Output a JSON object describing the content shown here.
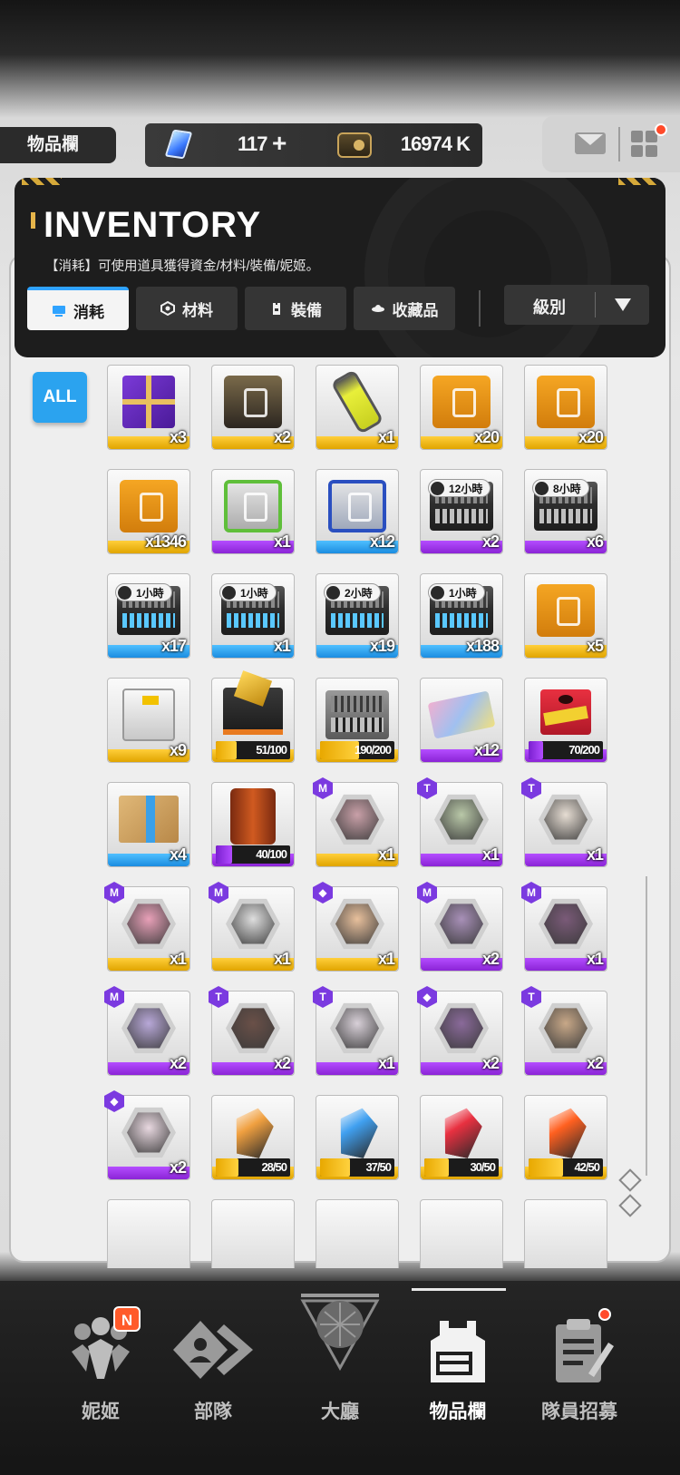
{
  "topbar": {
    "page_label": "物品欄",
    "gems": "117",
    "gems_plus": "+",
    "credits": "16974 K"
  },
  "inventory": {
    "title": "INVENTORY",
    "description": "【消耗】可使用道具獲得資金/材料/裝備/妮姬。",
    "tabs": [
      {
        "label": "消耗",
        "icon": "consumable-icon",
        "active": true
      },
      {
        "label": "材料",
        "icon": "material-icon",
        "active": false
      },
      {
        "label": "裝備",
        "icon": "equipment-icon",
        "active": false
      },
      {
        "label": "收藏品",
        "icon": "collection-icon",
        "active": false
      }
    ],
    "sort_label": "級別",
    "filter_all": "ALL"
  },
  "items": [
    {
      "kind": "gift",
      "rarity": "gold",
      "count": "x3"
    },
    {
      "kind": "crate-dark",
      "rarity": "gold",
      "count": "x2"
    },
    {
      "kind": "canister",
      "rarity": "gold",
      "count": "x1"
    },
    {
      "kind": "crate-orange",
      "rarity": "gold",
      "count": "x20"
    },
    {
      "kind": "crate-orange",
      "rarity": "gold",
      "count": "x20"
    },
    {
      "kind": "crate-orange",
      "rarity": "gold",
      "count": "x1346"
    },
    {
      "kind": "crate-green",
      "rarity": "purple",
      "count": "x1"
    },
    {
      "kind": "crate-blue",
      "rarity": "blue",
      "count": "x12"
    },
    {
      "kind": "case",
      "rarity": "purple",
      "count": "x2",
      "timer": "12小時"
    },
    {
      "kind": "case",
      "rarity": "purple",
      "count": "x6",
      "timer": "8小時"
    },
    {
      "kind": "case",
      "rarity": "blue",
      "count": "x17",
      "timer": "1小時"
    },
    {
      "kind": "case",
      "rarity": "blue",
      "count": "x1",
      "timer": "1小時"
    },
    {
      "kind": "case",
      "rarity": "blue",
      "count": "x19",
      "timer": "2小時"
    },
    {
      "kind": "case",
      "rarity": "blue",
      "count": "x188",
      "timer": "1小時"
    },
    {
      "kind": "crate-orange",
      "rarity": "gold",
      "count": "x5"
    },
    {
      "kind": "box-white",
      "rarity": "gold",
      "count": "x9"
    },
    {
      "kind": "chest-dark",
      "rarity": "gold",
      "progress": "51/100",
      "fill": 0.51,
      "fillColor": "gold"
    },
    {
      "kind": "case-grey",
      "rarity": "gold",
      "progress": "190/200",
      "fill": 0.95,
      "fillColor": "gold"
    },
    {
      "kind": "box-gift",
      "rarity": "purple",
      "count": "x12"
    },
    {
      "kind": "lucky-box",
      "rarity": "purple",
      "progress": "70/200",
      "fill": 0.35,
      "fillColor": "purple"
    },
    {
      "kind": "cardboard",
      "rarity": "blue",
      "count": "x4"
    },
    {
      "kind": "barrel",
      "rarity": "purple",
      "progress": "40/100",
      "fill": 0.4,
      "fillColor": "purple"
    },
    {
      "kind": "portrait",
      "rarity": "gold",
      "count": "x1",
      "badge": "M",
      "tone": "#c9a0a8"
    },
    {
      "kind": "portrait",
      "rarity": "purple",
      "count": "x1",
      "badge": "T",
      "tone": "#b9c8a8"
    },
    {
      "kind": "portrait",
      "rarity": "purple",
      "count": "x1",
      "badge": "T",
      "tone": "#e6ddd3"
    },
    {
      "kind": "portrait",
      "rarity": "gold",
      "count": "x1",
      "badge": "M",
      "tone": "#e8a0b8"
    },
    {
      "kind": "portrait",
      "rarity": "gold",
      "count": "x1",
      "badge": "M",
      "tone": "#dedede"
    },
    {
      "kind": "portrait",
      "rarity": "gold",
      "count": "x1",
      "badge": "◆",
      "tone": "#e8c09c"
    },
    {
      "kind": "portrait",
      "rarity": "purple",
      "count": "x2",
      "badge": "M",
      "tone": "#a890b8"
    },
    {
      "kind": "portrait",
      "rarity": "purple",
      "count": "x1",
      "badge": "M",
      "tone": "#7a5a78"
    },
    {
      "kind": "portrait",
      "rarity": "purple",
      "count": "x2",
      "badge": "M",
      "tone": "#b8a8d8"
    },
    {
      "kind": "portrait",
      "rarity": "purple",
      "count": "x2",
      "badge": "T",
      "tone": "#6a5048"
    },
    {
      "kind": "portrait",
      "rarity": "purple",
      "count": "x1",
      "badge": "T",
      "tone": "#d8d0d8"
    },
    {
      "kind": "portrait",
      "rarity": "purple",
      "count": "x2",
      "badge": "◆",
      "tone": "#8a6a9a"
    },
    {
      "kind": "portrait",
      "rarity": "purple",
      "count": "x2",
      "badge": "T",
      "tone": "#c8a888"
    },
    {
      "kind": "portrait",
      "rarity": "purple",
      "count": "x2",
      "badge": "◆",
      "tone": "#e8d8e0"
    },
    {
      "kind": "shard",
      "rarity": "gold",
      "progress": "28/50",
      "fill": 0.56,
      "fillColor": "gold",
      "shardColor": "#f0a040"
    },
    {
      "kind": "shard",
      "rarity": "gold",
      "progress": "37/50",
      "fill": 0.74,
      "fillColor": "gold",
      "shardColor": "#40a0f0"
    },
    {
      "kind": "shard",
      "rarity": "gold",
      "progress": "30/50",
      "fill": 0.6,
      "fillColor": "gold",
      "shardColor": "#e83040"
    },
    {
      "kind": "shard",
      "rarity": "gold",
      "progress": "42/50",
      "fill": 0.84,
      "fillColor": "gold",
      "shardColor": "#ff6020"
    },
    {
      "kind": "partial",
      "rarity": "purple"
    },
    {
      "kind": "partial",
      "rarity": "gold"
    },
    {
      "kind": "partial",
      "rarity": "gold"
    },
    {
      "kind": "partial",
      "rarity": "gold"
    },
    {
      "kind": "partial",
      "rarity": "gold"
    }
  ],
  "nav": [
    {
      "label": "妮姬",
      "icon": "nikke-icon",
      "active": false
    },
    {
      "label": "部隊",
      "icon": "squad-icon",
      "active": false
    },
    {
      "label": "大廳",
      "icon": "lobby-icon",
      "active": false
    },
    {
      "label": "物品欄",
      "icon": "inventory-icon",
      "active": true
    },
    {
      "label": "隊員招募",
      "icon": "recruit-icon",
      "active": false
    }
  ],
  "nav_badge": "N",
  "colors": {
    "accent": "#2ba3ef",
    "gold": "#f2b400",
    "purple": "#9b35e8",
    "blue": "#2a9ef0",
    "alert": "#ff4a2a"
  }
}
